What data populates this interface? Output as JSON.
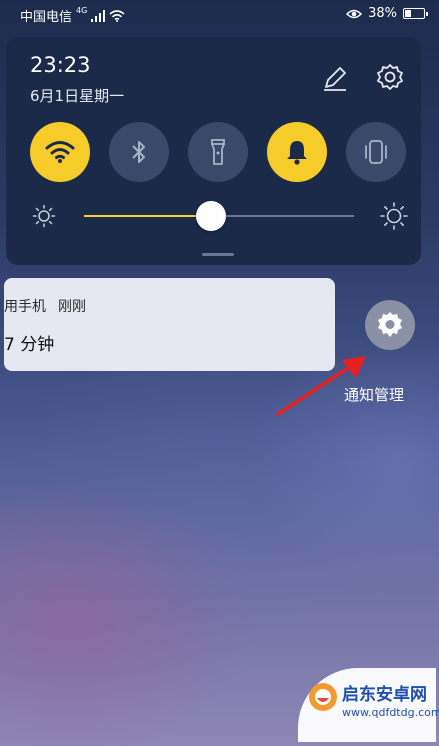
{
  "status_bar": {
    "carrier": "中国电信",
    "network": "4G",
    "battery_percent": "38%",
    "battery_level": 0.38
  },
  "quick_panel": {
    "time": "23:23",
    "date": "6月1日星期一",
    "toggles": [
      {
        "name": "wifi",
        "on": true
      },
      {
        "name": "bluetooth",
        "on": false
      },
      {
        "name": "flashlight",
        "on": false
      },
      {
        "name": "bell",
        "on": true
      },
      {
        "name": "vibrate",
        "on": false
      }
    ],
    "brightness_level": 0.47,
    "accent_color": "#f5cc2a"
  },
  "notification": {
    "app": "用手机",
    "time": "刚刚",
    "body": "7 分钟"
  },
  "notification_settings": {
    "label": "通知管理"
  },
  "watermark": {
    "title": "启东安卓网",
    "url": "www.qdfdtdg.com"
  }
}
